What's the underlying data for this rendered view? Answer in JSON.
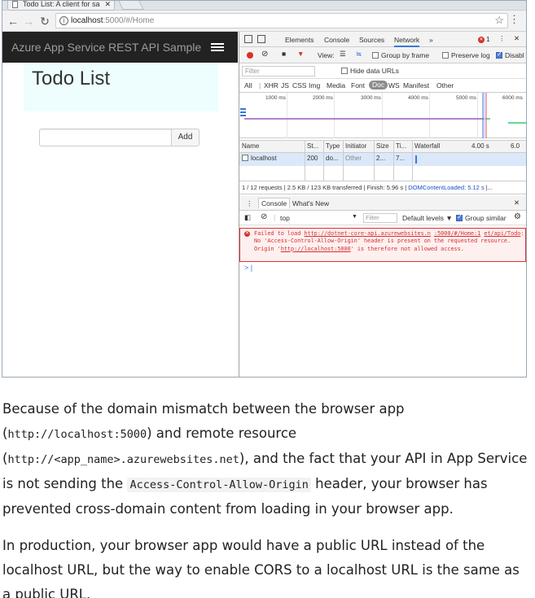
{
  "browser": {
    "tab_title": "Todo List: A client for sa",
    "url_host": "localhost",
    "url_path": ":5000/#/Home"
  },
  "app": {
    "brand": "Azure App Service REST API Sample",
    "heading": "Todo List",
    "add_label": "Add"
  },
  "devtools": {
    "tabs": [
      "Elements",
      "Console",
      "Sources",
      "Network",
      "»"
    ],
    "error_count": "1",
    "net_toolbar": {
      "view_label": "View:",
      "group_by_frame": "Group by frame",
      "preserve_log": "Preserve log",
      "disable_cache": "Disabl"
    },
    "filter_placeholder": "Filter",
    "hide_data_urls": "Hide data URLs",
    "types": [
      "All",
      "XHR",
      "JS",
      "CSS",
      "Img",
      "Media",
      "Font",
      "Doc",
      "WS",
      "Manifest",
      "Other"
    ],
    "timeline_ticks": [
      "1000 ms",
      "2000 ms",
      "3000 ms",
      "4000 ms",
      "5000 ms",
      "6000 ms"
    ],
    "columns": [
      "Name",
      "St...",
      "Type",
      "Initiator",
      "Size",
      "Ti...",
      "Waterfall",
      "4.00 s",
      "6.0"
    ],
    "row": {
      "name": "localhost",
      "status": "200",
      "type": "do...",
      "initiator": "Other",
      "size": "2...",
      "time": "7..."
    },
    "summary_prefix": "1 / 12 requests | 2.5 KB / 123 KB transferred | Finish: 5.96 s |",
    "summary_dcl": "DOMContentLoaded: 5.12 s",
    "summary_suffix": "|...",
    "drawer_tabs": [
      "Console",
      "What's New"
    ],
    "console": {
      "context": "top",
      "filter_placeholder": "Filter",
      "levels": "Default levels ▼",
      "group_similar": "Group similar"
    },
    "error": {
      "part1": "Failed to load ",
      "url1": "http://dotnet-core-api.azurewebsites.n",
      "url2": ":5000/#/Home:1",
      "url3": "et/api/Todo",
      "part2": ": No 'Access-Control-Allow-Origin' header is present on the requested resource. Origin '",
      "url4": "http://localhost:5000",
      "part3": "' is therefore not allowed access."
    },
    "prompt": "> |"
  },
  "article": {
    "p1_a": "Because of the domain mismatch between the browser app (",
    "p1_code1": "http://localhost:5000",
    "p1_b": ") and remote resource (",
    "p1_code2": "http://<app_name>.azurewebsites.net",
    "p1_c": "), and the fact that your API in App Service is not sending the ",
    "p1_code3": "Access-Control-Allow-Origin",
    "p1_d": " header, your browser has prevented cross-domain content from loading in your browser app.",
    "p2": "In production, your browser app would have a public URL instead of the localhost URL, but the way to enable CORS to a localhost URL is the same as a public URL."
  },
  "colors": {
    "navbar": "#222222",
    "jumbotron": "#eefeff",
    "error_red": "#d32f2f",
    "devtools_blue": "#3879d9",
    "selected_row": "#dbe8f9"
  }
}
